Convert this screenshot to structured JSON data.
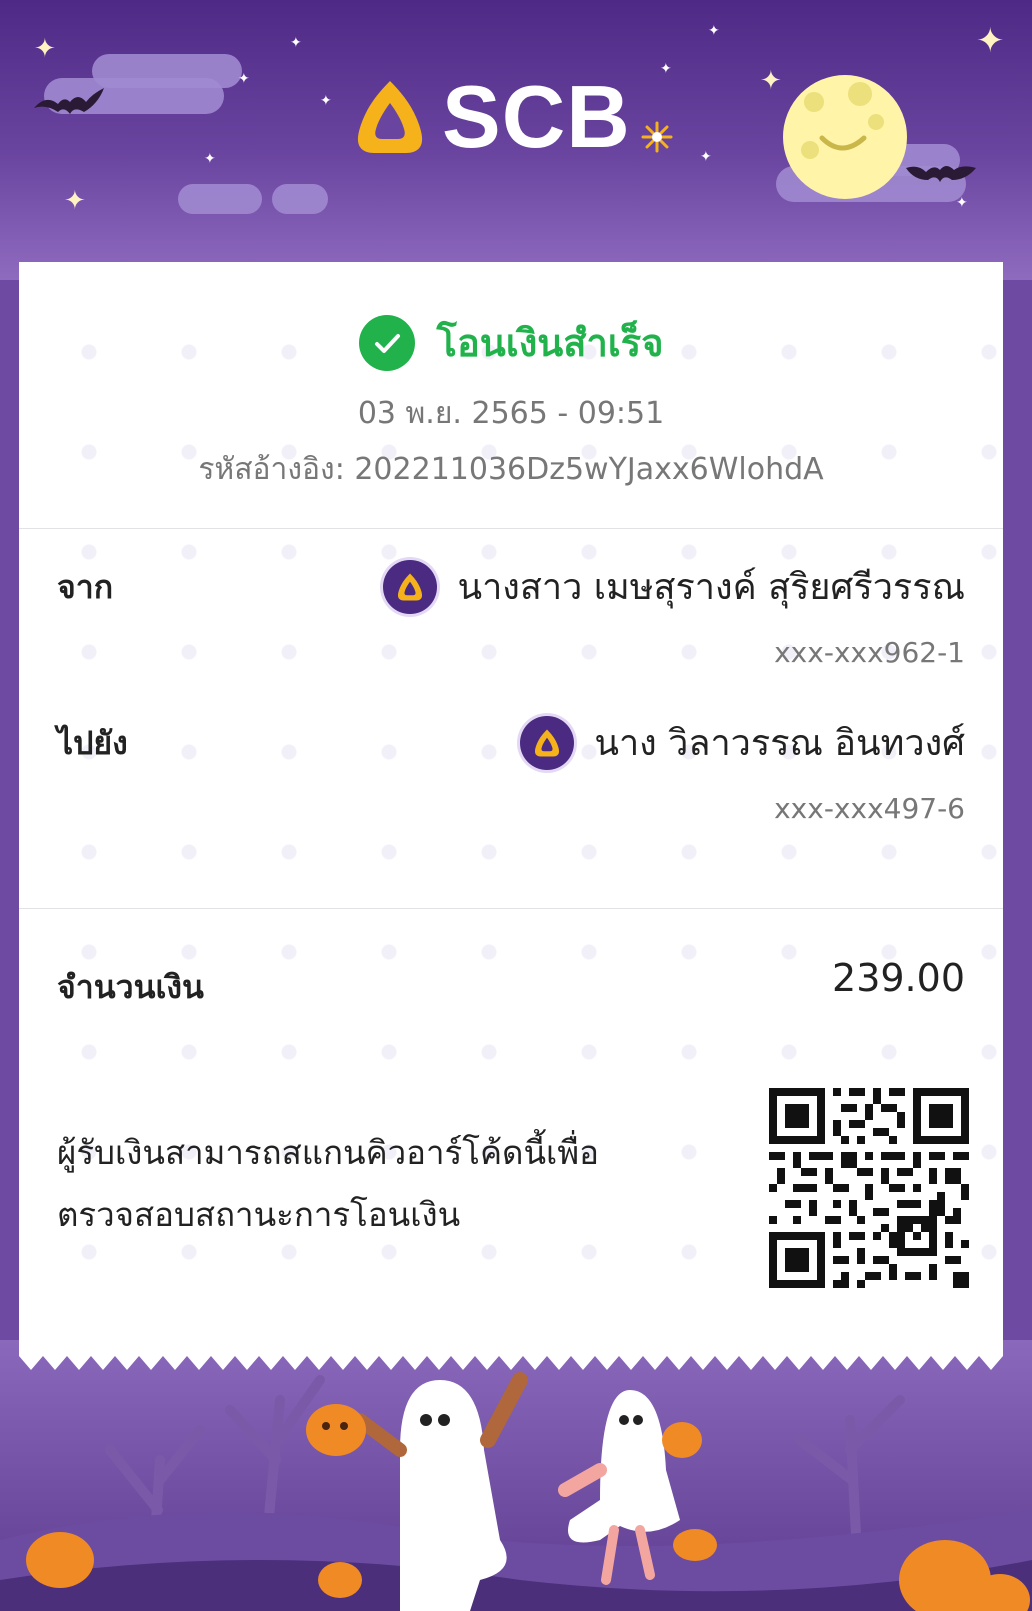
{
  "brand": {
    "name": "SCB"
  },
  "status": {
    "title": "โอนเงินสำเร็จ"
  },
  "transaction": {
    "datetime": "03 พ.ย. 2565 - 09:51",
    "ref_label": "รหัสอ้างอิง:",
    "ref_value": "202211036Dz5wYJaxx6WlohdA"
  },
  "from": {
    "label": "จาก",
    "name": "นางสาว เมษสุรางค์ สุริยศรีวรรณ",
    "account": "xxx-xxx962-1"
  },
  "to": {
    "label": "ไปยัง",
    "name": "นาง วิลาวรรณ อินทวงศ์",
    "account": "xxx-xxx497-6"
  },
  "amount": {
    "label": "จำนวนเงิน",
    "value": "239.00"
  },
  "qr": {
    "note_line1": "ผู้รับเงินสามารถสแกนคิวอาร์โค้ดนี้เพื่อ",
    "note_line2": "ตรวจสอบสถานะการโอนเงิน"
  },
  "colors": {
    "brand_purple": "#4b2a82",
    "success_green": "#21b24c",
    "logo_gold": "#f5b21b"
  }
}
